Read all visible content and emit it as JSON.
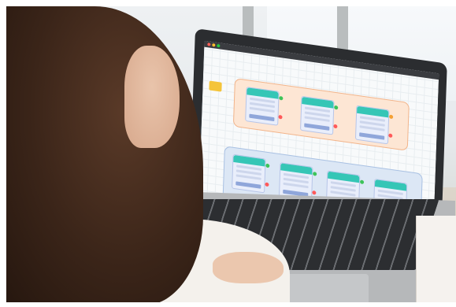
{
  "scene": {
    "subject": "person-using-laptop",
    "screen_app": "workflow-diagram-editor"
  },
  "colors": {
    "lane_orange": "#fde6d4",
    "lane_blue": "#dce7f5",
    "node_header": "#35c6b6",
    "port_green": "#3ec45a",
    "port_red": "#ff5a5a",
    "folder": "#f4c43a"
  }
}
